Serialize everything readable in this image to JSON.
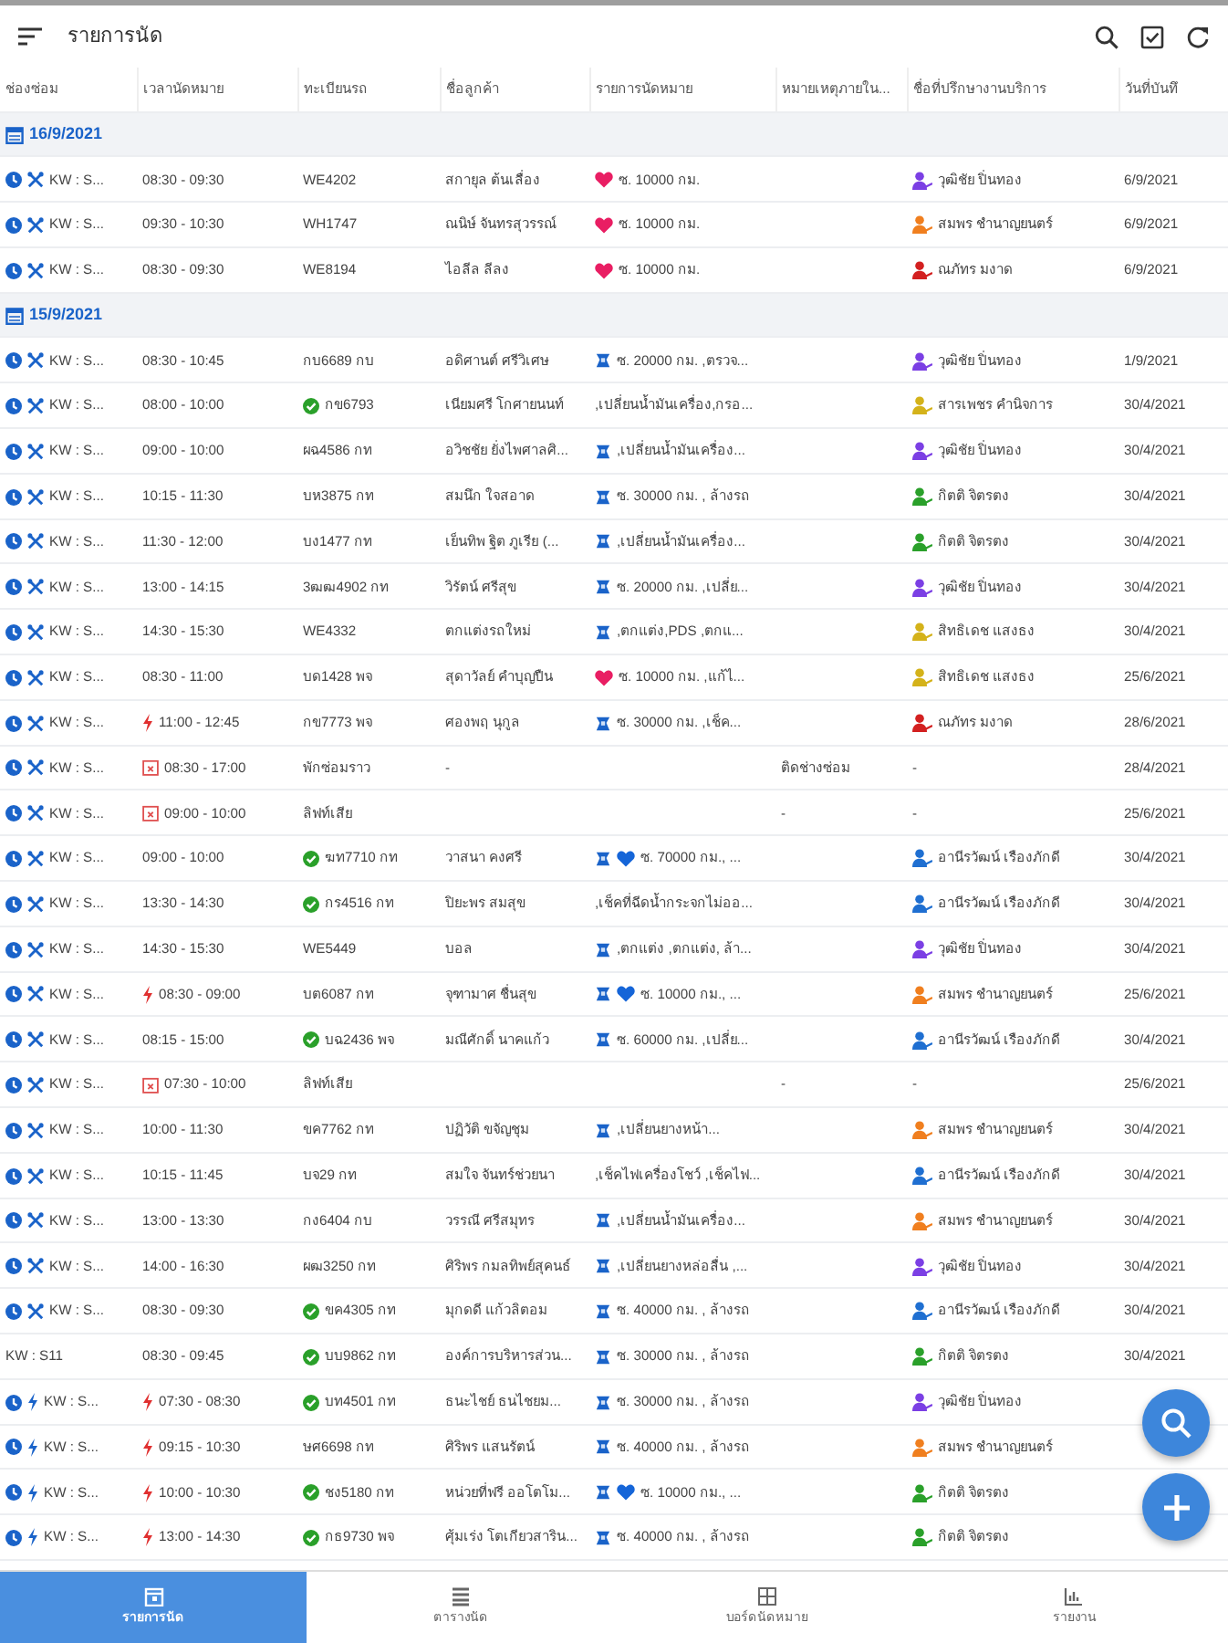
{
  "app_bar": {
    "title": "รายการนัด"
  },
  "columns": [
    "ช่องซ่อม",
    "เวลานัดหมาย",
    "ทะเบียนรถ",
    "ชื่อลูกค้า",
    "รายการนัดหมาย",
    "หมายเหตุภายใน...",
    "ชื่อที่ปรึกษางานบริการ",
    "วันที่บันทึ"
  ],
  "groups": [
    {
      "date": "16/9/2021",
      "rows": [
        {
          "kind": "repair",
          "clock": true,
          "bay": "KW : S...",
          "urgent": false,
          "blocked": false,
          "time": "08:30 - 09:30",
          "confirmed": false,
          "plate": "WE4202",
          "customer": "สกายุล ต้นเลื่อง",
          "service_icon": false,
          "heart": {
            "color": "#e91e63"
          },
          "service": "ซ. 10000 กม.",
          "advisor": {
            "name": "วุฒิชัย ปิ่นทอง",
            "color": "#7b3fe4"
          },
          "date": "6/9/2021"
        },
        {
          "kind": "repair",
          "clock": true,
          "bay": "KW : S...",
          "urgent": false,
          "blocked": false,
          "time": "09:30 - 10:30",
          "confirmed": false,
          "plate": "WH1747",
          "customer": "ณนิษ์ จันทรสุวรรณ์",
          "service_icon": false,
          "heart": {
            "color": "#e91e63"
          },
          "service": "ซ. 10000 กม.",
          "advisor": {
            "name": "สมพร ชำนาญยนตร์",
            "color": "#f07f1f"
          },
          "date": "6/9/2021"
        },
        {
          "kind": "repair",
          "clock": true,
          "bay": "KW : S...",
          "urgent": false,
          "blocked": false,
          "time": "08:30 - 09:30",
          "confirmed": false,
          "plate": "WE8194",
          "customer": "ไอลีล ลีลง",
          "service_icon": false,
          "heart": {
            "color": "#e91e63"
          },
          "service": "ซ. 10000 กม.",
          "advisor": {
            "name": "ณภัทร มงาด",
            "color": "#d32020"
          },
          "date": "6/9/2021"
        }
      ]
    },
    {
      "date": "15/9/2021",
      "rows": [
        {
          "kind": "repair",
          "clock": true,
          "bay": "KW : S...",
          "urgent": false,
          "blocked": false,
          "time": "08:30 - 10:45",
          "confirmed": false,
          "plate": "กบ6689 กบ",
          "customer": "อดิศานต์ ศรีวิเศษ",
          "service_icon": true,
          "service": "ซ. 20000 กม. ,ตรวจ...",
          "advisor": {
            "name": "วุฒิชัย ปิ่นทอง",
            "color": "#7b3fe4"
          },
          "date": "1/9/2021"
        },
        {
          "kind": "repair",
          "clock": true,
          "bay": "KW : S...",
          "urgent": false,
          "blocked": false,
          "time": "08:00 - 10:00",
          "confirmed": true,
          "plate": "กข6793",
          "customer": "เนียมศรี โกศายนนท์",
          "service_icon": false,
          "service": ",เปลี่ยนน้ำมันเครื่อง,กรอ...",
          "advisor": {
            "name": "สารเพชร คำนิจการ",
            "color": "#d4b21a"
          },
          "date": "30/4/2021"
        },
        {
          "kind": "repair",
          "clock": true,
          "bay": "KW : S...",
          "urgent": false,
          "blocked": false,
          "time": "09:00 - 10:00",
          "confirmed": false,
          "plate": "ผฉ4586 กท",
          "customer": "อวิชชัย ยั่งไพศาลศิ...",
          "service_icon": true,
          "service": ",เปลี่ยนน้ำมันเครื่อง...",
          "advisor": {
            "name": "วุฒิชัย ปิ่นทอง",
            "color": "#7b3fe4"
          },
          "date": "30/4/2021"
        },
        {
          "kind": "repair",
          "clock": true,
          "bay": "KW : S...",
          "urgent": false,
          "blocked": false,
          "time": "10:15 - 11:30",
          "confirmed": false,
          "plate": "บห3875 กท",
          "customer": "สมนึก ใจสอาด",
          "service_icon": true,
          "service": "ซ. 30000 กม. , ล้างรถ",
          "advisor": {
            "name": "กิตติ จิตรตง",
            "color": "#2aa02a"
          },
          "date": "30/4/2021"
        },
        {
          "kind": "repair",
          "clock": true,
          "bay": "KW : S...",
          "urgent": false,
          "blocked": false,
          "time": "11:30 - 12:00",
          "confirmed": false,
          "plate": "บง1477 กท",
          "customer": "เย็นทิพ ฐิต ภูเรีย (...",
          "service_icon": true,
          "service": ",เปลี่ยนน้ำมันเครื่อง...",
          "advisor": {
            "name": "กิตติ จิตรตง",
            "color": "#2aa02a"
          },
          "date": "30/4/2021"
        },
        {
          "kind": "repair",
          "clock": true,
          "bay": "KW : S...",
          "urgent": false,
          "blocked": false,
          "time": "13:00 - 14:15",
          "confirmed": false,
          "plate": "3ฒฒ4902 กท",
          "customer": "วิรัตน์ ศรีสุข",
          "service_icon": true,
          "service": "ซ. 20000 กม. ,เปลี่ย...",
          "advisor": {
            "name": "วุฒิชัย ปิ่นทอง",
            "color": "#7b3fe4"
          },
          "date": "30/4/2021"
        },
        {
          "kind": "repair",
          "clock": true,
          "bay": "KW : S...",
          "urgent": false,
          "blocked": false,
          "time": "14:30 - 15:30",
          "confirmed": false,
          "plate": "WE4332",
          "customer": "ตกแต่งรถใหม่",
          "service_icon": true,
          "service": ",ตกแต่ง,PDS ,ตกแ...",
          "advisor": {
            "name": "สิทธิเดช แสงธง",
            "color": "#d4b21a"
          },
          "date": "30/4/2021"
        },
        {
          "kind": "repair",
          "clock": true,
          "bay": "KW : S...",
          "urgent": false,
          "blocked": false,
          "time": "08:30 - 11:00",
          "confirmed": false,
          "plate": "บด1428 พจ",
          "customer": "สุดาวัลย์ คำบุญปืน",
          "service_icon": false,
          "heart": {
            "color": "#e91e63"
          },
          "service": "ซ. 10000 กม. ,แก้ไ...",
          "advisor": {
            "name": "สิทธิเดช แสงธง",
            "color": "#d4b21a"
          },
          "date": "25/6/2021"
        },
        {
          "kind": "repair",
          "clock": true,
          "bay": "KW : S...",
          "urgent": true,
          "blocked": false,
          "time": "11:00 - 12:45",
          "confirmed": false,
          "plate": "กข7773 พจ",
          "customer": "ศองพฤ นุกูล",
          "service_icon": true,
          "service": "ซ. 30000 กม. ,เช็ค...",
          "advisor": {
            "name": "ณภัทร มงาด",
            "color": "#d32020"
          },
          "date": "28/6/2021"
        },
        {
          "kind": "repair",
          "clock": true,
          "bay": "KW : S...",
          "urgent": false,
          "blocked": true,
          "time": "08:30 - 17:00",
          "confirmed": false,
          "plate": "พักซ่อมราว",
          "customer": "-",
          "service_icon": false,
          "note": "ติดช่างซ่อม",
          "advisor": {
            "name": "-"
          },
          "date": "28/4/2021"
        },
        {
          "kind": "repair",
          "clock": true,
          "bay": "KW : S...",
          "urgent": false,
          "blocked": true,
          "time": "09:00 - 10:00",
          "confirmed": false,
          "plate": "ลิฟท์เสีย",
          "service_icon": false,
          "note": "-",
          "advisor": {
            "name": "-"
          },
          "date": "25/6/2021"
        },
        {
          "kind": "repair",
          "clock": true,
          "bay": "KW : S...",
          "urgent": false,
          "blocked": false,
          "time": "09:00 - 10:00",
          "confirmed": true,
          "plate": "ฆท7710 กท",
          "customer": "วาสนา คงศรี",
          "service_icon": true,
          "heart": {
            "color": "#1565d8"
          },
          "service": "ซ. 70000 กม., ...",
          "advisor": {
            "name": "อานีรวัฒน์ เรืองภักดี",
            "color": "#1f6fd1"
          },
          "date": "30/4/2021"
        },
        {
          "kind": "repair",
          "clock": true,
          "bay": "KW : S...",
          "urgent": false,
          "blocked": false,
          "time": "13:30 - 14:30",
          "confirmed": true,
          "plate": "กร4516 กท",
          "customer": "ปิยะพร สมสุข",
          "service_icon": false,
          "service": ",เช็คที่ฉีดน้ำกระจกไม่ออ...",
          "advisor": {
            "name": "อานีรวัฒน์ เรืองภักดี",
            "color": "#1f6fd1"
          },
          "date": "30/4/2021"
        },
        {
          "kind": "repair",
          "clock": true,
          "bay": "KW : S...",
          "urgent": false,
          "blocked": false,
          "time": "14:30 - 15:30",
          "confirmed": false,
          "plate": "WE5449",
          "customer": "บอล",
          "service_icon": true,
          "service": ",ตกแต่ง ,ตกแต่ง, ล้า...",
          "advisor": {
            "name": "วุฒิชัย ปิ่นทอง",
            "color": "#7b3fe4"
          },
          "date": "30/4/2021"
        },
        {
          "kind": "repair",
          "clock": true,
          "bay": "KW : S...",
          "urgent": true,
          "blocked": false,
          "time": "08:30 - 09:00",
          "confirmed": false,
          "plate": "บต6087 กท",
          "customer": "จุฑามาศ ชื่นสุข",
          "service_icon": true,
          "heart": {
            "color": "#1565d8"
          },
          "service": "ซ. 10000 กม., ...",
          "advisor": {
            "name": "สมพร ชำนาญยนตร์",
            "color": "#f07f1f"
          },
          "date": "25/6/2021"
        },
        {
          "kind": "repair",
          "clock": true,
          "bay": "KW : S...",
          "urgent": false,
          "blocked": false,
          "time": "08:15 - 15:00",
          "confirmed": true,
          "plate": "บฉ2436 พจ",
          "customer": "มณีศักดิ์ นาคแก้ว",
          "service_icon": true,
          "service": "ซ. 60000 กม. ,เปลี่ย...",
          "advisor": {
            "name": "อานีรวัฒน์ เรืองภักดี",
            "color": "#1f6fd1"
          },
          "date": "30/4/2021"
        },
        {
          "kind": "repair",
          "clock": true,
          "bay": "KW : S...",
          "urgent": false,
          "blocked": true,
          "time": "07:30 - 10:00",
          "confirmed": false,
          "plate": "ลิฟท์เสีย",
          "service_icon": false,
          "note": "-",
          "advisor": {
            "name": "-"
          },
          "date": "25/6/2021"
        },
        {
          "kind": "repair",
          "clock": true,
          "bay": "KW : S...",
          "urgent": false,
          "blocked": false,
          "time": "10:00 - 11:30",
          "confirmed": false,
          "plate": "ขค7762 กท",
          "customer": "ปฏิวัติ ขจัญชุม",
          "service_icon": true,
          "service": ",เปลี่ยนยางหน้า...",
          "advisor": {
            "name": "สมพร ชำนาญยนตร์",
            "color": "#f07f1f"
          },
          "date": "30/4/2021"
        },
        {
          "kind": "repair",
          "clock": true,
          "bay": "KW : S...",
          "urgent": false,
          "blocked": false,
          "time": "10:15 - 11:45",
          "confirmed": false,
          "plate": "บจ29 กท",
          "customer": "สมใจ จันทร์ช่วยนา",
          "service_icon": false,
          "service": ",เช็คไฟเครื่องโชว์ ,เช็คไฟ...",
          "advisor": {
            "name": "อานีรวัฒน์ เรืองภักดี",
            "color": "#1f6fd1"
          },
          "date": "30/4/2021"
        },
        {
          "kind": "repair",
          "clock": true,
          "bay": "KW : S...",
          "urgent": false,
          "blocked": false,
          "time": "13:00 - 13:30",
          "confirmed": false,
          "plate": "กง6404 กบ",
          "customer": "วรรณี ศรีสมุทร",
          "service_icon": true,
          "service": ",เปลี่ยนน้ำมันเครื่อง...",
          "advisor": {
            "name": "สมพร ชำนาญยนตร์",
            "color": "#f07f1f"
          },
          "date": "30/4/2021"
        },
        {
          "kind": "repair",
          "clock": true,
          "bay": "KW : S...",
          "urgent": false,
          "blocked": false,
          "time": "14:00 - 16:30",
          "confirmed": false,
          "plate": "ผฒ3250 กท",
          "customer": "ศิริพร กมลทิพย์สุคนธ์",
          "service_icon": true,
          "service": ",เปลี่ยนยางหล่อลื่น ,...",
          "advisor": {
            "name": "วุฒิชัย ปิ่นทอง",
            "color": "#7b3fe4"
          },
          "date": "30/4/2021"
        },
        {
          "kind": "repair",
          "clock": true,
          "bay": "KW : S...",
          "urgent": false,
          "blocked": false,
          "time": "08:30 - 09:30",
          "confirmed": true,
          "plate": "ขค4305 กท",
          "customer": "มุกดดี แก้วลิตอม",
          "service_icon": true,
          "service": "ซ. 40000 กม. , ล้างรถ",
          "advisor": {
            "name": "อานีรวัฒน์ เรืองภักดี",
            "color": "#1f6fd1"
          },
          "date": "30/4/2021"
        },
        {
          "kind": "plain",
          "clock": false,
          "bay": "KW : S11",
          "urgent": false,
          "blocked": false,
          "time": "08:30 - 09:45",
          "confirmed": true,
          "plate": "บบ9862 กท",
          "customer": "องค์การบริหารส่วน...",
          "service_icon": true,
          "service": "ซ. 30000 กม. , ล้างรถ",
          "advisor": {
            "name": "กิตติ จิตรตง",
            "color": "#2aa02a"
          },
          "date": "30/4/2021"
        },
        {
          "kind": "express",
          "clock": true,
          "bay": "KW : S...",
          "urgent": true,
          "blocked": false,
          "time": "07:30 - 08:30",
          "confirmed": true,
          "plate": "บท4501 กท",
          "customer": "ธนะไชย์ ธนไชยม...",
          "service_icon": true,
          "service": "ซ. 30000 กม. , ล้างรถ",
          "advisor": {
            "name": "วุฒิชัย ปิ่นทอง",
            "color": "#7b3fe4"
          }
        },
        {
          "kind": "express",
          "clock": true,
          "bay": "KW : S...",
          "urgent": true,
          "blocked": false,
          "time": "09:15 - 10:30",
          "confirmed": false,
          "plate": "ษศ6698 กท",
          "customer": "ศิริพร แสนรัตน์",
          "service_icon": true,
          "service": "ซ. 40000 กม. , ล้างรถ",
          "advisor": {
            "name": "สมพร ชำนาญยนตร์",
            "color": "#f07f1f"
          }
        },
        {
          "kind": "express",
          "clock": true,
          "bay": "KW : S...",
          "urgent": true,
          "blocked": false,
          "time": "10:00 - 10:30",
          "confirmed": true,
          "plate": "ชง5180 กท",
          "customer": "หน่วยที่ฟรี ออโตโม...",
          "service_icon": true,
          "heart": {
            "color": "#1565d8"
          },
          "service": "ซ. 10000 กม., ...",
          "advisor": {
            "name": "กิตติ จิตรตง",
            "color": "#2aa02a"
          }
        },
        {
          "kind": "express",
          "clock": true,
          "bay": "KW : S...",
          "urgent": true,
          "blocked": false,
          "time": "13:00 - 14:30",
          "confirmed": true,
          "plate": "กธ9730 พจ",
          "customer": "ศุ้มเร่ง โตเกียวสาริน...",
          "service_icon": true,
          "service": "ซ. 40000 กม. , ล้างรถ",
          "advisor": {
            "name": "กิตติ จิตรตง",
            "color": "#2aa02a"
          }
        }
      ]
    }
  ],
  "bottom_nav": [
    {
      "label": "รายการนัด",
      "selected": true
    },
    {
      "label": "ตารางนัด",
      "selected": false
    },
    {
      "label": "บอร์ดนัดหมาย",
      "selected": false
    },
    {
      "label": "รายงาน",
      "selected": false
    }
  ]
}
